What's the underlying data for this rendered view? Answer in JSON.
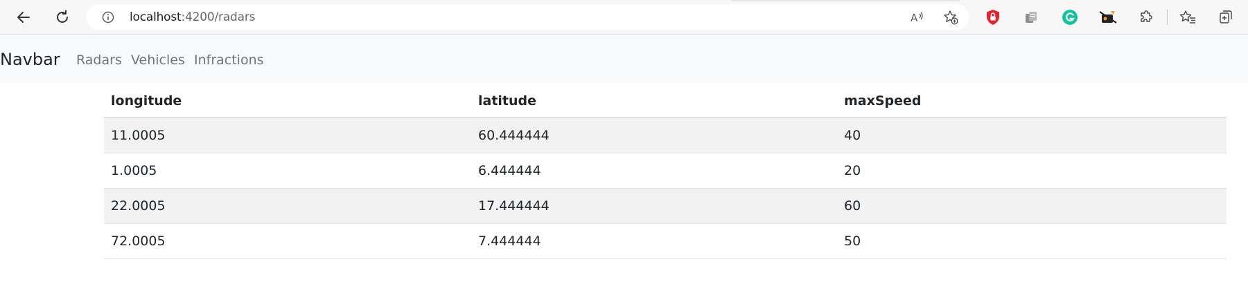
{
  "browser": {
    "url_host": "localhost",
    "url_rest": ":4200/radars"
  },
  "navbar": {
    "brand": "Navbar",
    "links": [
      "Radars",
      "Vehicles",
      "Infractions"
    ]
  },
  "table": {
    "headers": [
      "longitude",
      "latitude",
      "maxSpeed"
    ],
    "rows": [
      [
        "11.0005",
        "60.444444",
        "40"
      ],
      [
        "1.0005",
        "6.444444",
        "20"
      ],
      [
        "22.0005",
        "17.444444",
        "60"
      ],
      [
        "72.0005",
        "7.444444",
        "50"
      ]
    ]
  },
  "colors": {
    "stripe": "#f2f2f2",
    "navbar_bg": "#f8f9fa",
    "link": "#6c757d"
  }
}
